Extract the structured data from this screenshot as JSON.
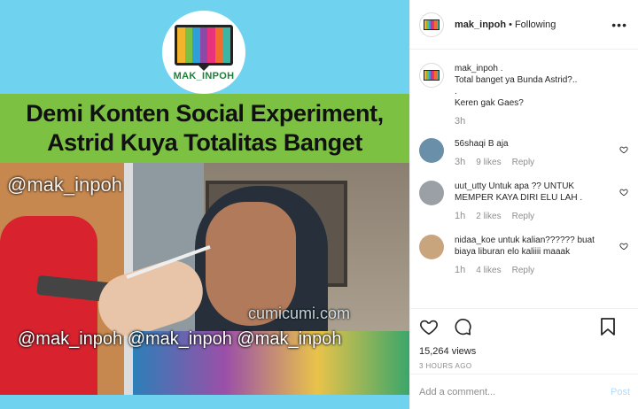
{
  "media": {
    "logo_text": "MAK_INPOH",
    "logo_colors": [
      "#f2b42c",
      "#7ac043",
      "#2d9fd9",
      "#8b4aa8",
      "#e8327c",
      "#f16d2b",
      "#3db5a5"
    ],
    "title_line1": "Demi Konten Social Experiment,",
    "title_line2": "Astrid Kuya Totalitas Banget",
    "watermark_top": "@mak_inpoh",
    "watermark_bottom": "@mak_inpoh @mak_inpoh @mak_inpoh",
    "watermark_site": "cumicumi.com"
  },
  "header": {
    "username": "mak_inpoh",
    "separator": "•",
    "follow_status": "Following",
    "more_icon": "ellipsis-icon"
  },
  "caption": {
    "username": "mak_inpoh",
    "lines": [
      "Total banget ya Bunda Astrid?..",
      ".",
      "Keren gak Gaes?"
    ],
    "time": "3h"
  },
  "comments": [
    {
      "username": "56shaqi",
      "text": "B aja",
      "time": "3h",
      "likes": "9 likes",
      "reply": "Reply",
      "avatar_color": "#6a8fa8"
    },
    {
      "username": "uut_utty",
      "text": "Untuk apa ?? UNTUK MEMPER KAYA DIRI ELU LAH .",
      "time": "1h",
      "likes": "2 likes",
      "reply": "Reply",
      "avatar_color": "#9aa0a6"
    },
    {
      "username": "nidaa_koe",
      "text": "untuk kalian?????? buat biaya liburan elo kaliiii maaak",
      "time": "1h",
      "likes": "4 likes",
      "reply": "Reply",
      "avatar_color": "#c9a57e"
    }
  ],
  "actions": {
    "like_icon": "heart-icon",
    "comment_icon": "comment-icon",
    "save_icon": "bookmark-icon",
    "views": "15,264 views",
    "posted": "3 HOURS AGO"
  },
  "add_comment": {
    "placeholder": "Add a comment...",
    "post_label": "Post"
  }
}
